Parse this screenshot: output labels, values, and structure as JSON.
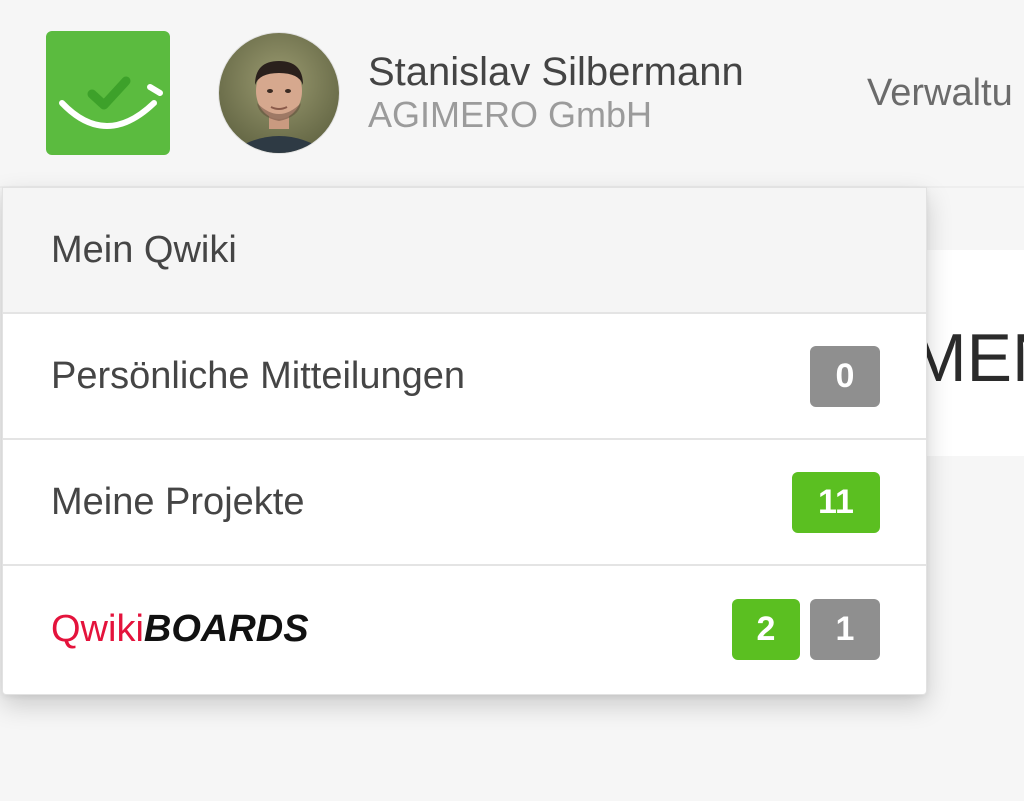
{
  "header": {
    "user_name": "Stanislav Silbermann",
    "company": "AGIMERO GmbH",
    "nav_link": "Verwaltu",
    "logo_icon": "smile-check-logo-icon",
    "logo_color": "#5bbb3f",
    "avatar": "user-avatar"
  },
  "background": {
    "heading_fragment": "MEN"
  },
  "dropdown": {
    "items": [
      {
        "label": "Mein Qwiki",
        "badges": []
      },
      {
        "label": "Persönliche Mitteilungen",
        "badges": [
          {
            "value": "0",
            "color": "#8f8f8f"
          }
        ]
      },
      {
        "label": "Meine Projekte",
        "badges": [
          {
            "value": "11",
            "color": "#5bbf21"
          }
        ]
      },
      {
        "label_part1": "Qwiki",
        "label_part2": "BOARDS",
        "badges": [
          {
            "value": "2",
            "color": "#5bbf21"
          },
          {
            "value": "1",
            "color": "#8f8f8f"
          }
        ]
      }
    ]
  },
  "colors": {
    "accent_green": "#5bbf21",
    "badge_gray": "#8f8f8f",
    "qwiki_red": "#e4133c"
  }
}
